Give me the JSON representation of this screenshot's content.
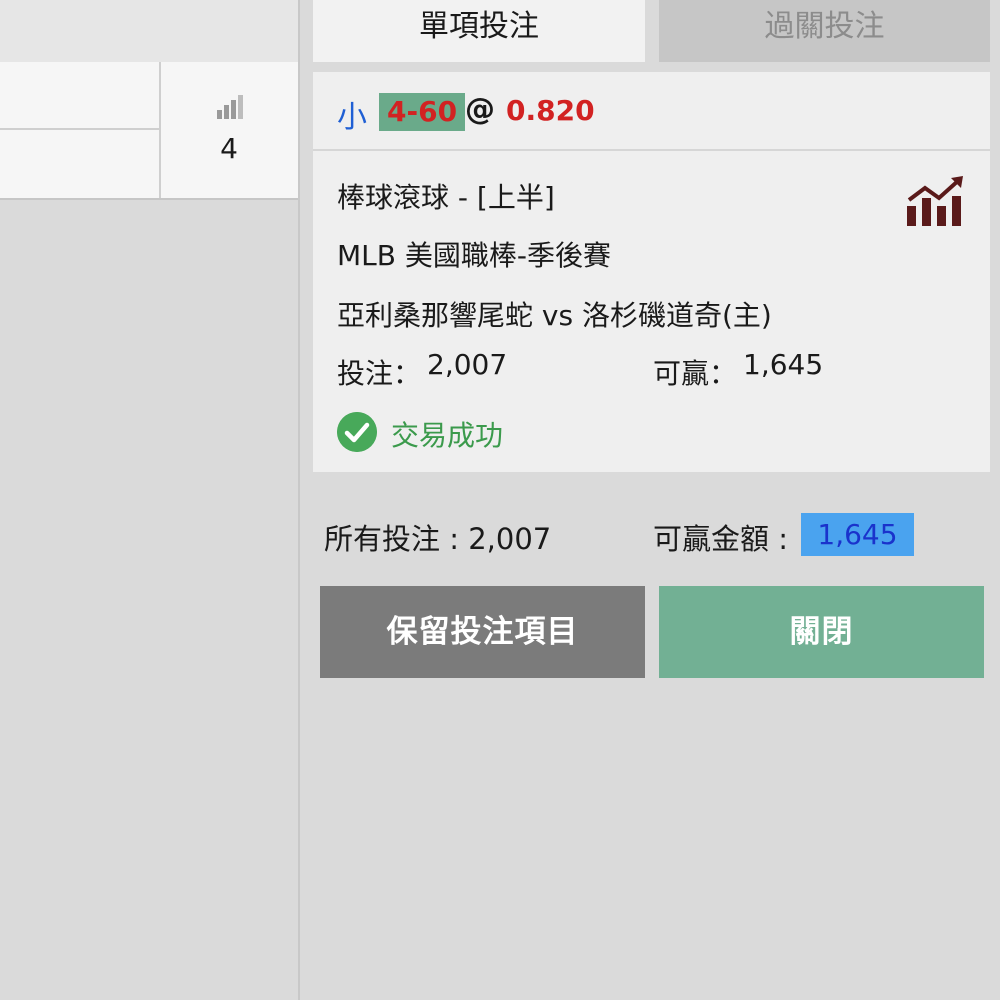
{
  "left_table": {
    "stat_count": "4"
  },
  "tabs": {
    "single": "單項投注",
    "parlay": "過關投注"
  },
  "bet": {
    "selection": "小",
    "line": "4-60",
    "at": "@",
    "odds": "0.820",
    "market": "棒球滾球 - [上半]",
    "league": "MLB 美國職棒-季後賽",
    "match": "亞利桑那響尾蛇 vs 洛杉磯道奇(主)",
    "stake_label": "投注：",
    "stake": "2,007",
    "win_label": "可贏：",
    "win": "1,645",
    "status": "交易成功"
  },
  "summary": {
    "total_label": "所有投注 : 2,007",
    "win_label": "可贏金額 :",
    "win_value": "1,645"
  },
  "buttons": {
    "keep": "保留投注項目",
    "close": "關閉"
  },
  "colors": {
    "selection": "#1f5fd4",
    "odds": "#d22222",
    "line_bg": "#6aaa8a",
    "success": "#48a95a",
    "win_box": "#4aa3ef",
    "close_button": "#72b094",
    "keep_button": "#7b7b7b",
    "trend_icon": "#5a1a1a"
  },
  "icons": {
    "stats": "bar-chart-icon",
    "trend": "trend-chart-icon",
    "status": "check-circle-icon"
  }
}
